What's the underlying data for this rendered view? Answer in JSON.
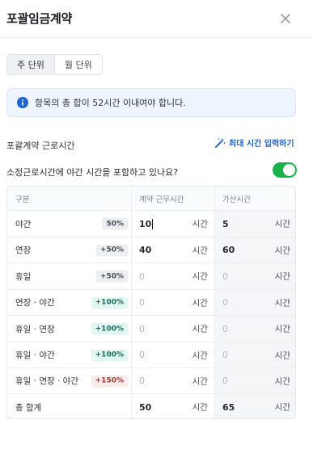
{
  "dialog": {
    "title": "포괄임금계약",
    "close_icon": "close-icon"
  },
  "period_toggle": {
    "options": [
      "주 단위",
      "월 단위"
    ],
    "selected": "주 단위"
  },
  "info": {
    "icon": "info-icon",
    "text": "항목의 총 합이 52시간 이내여야 합니다.",
    "accent": "#1e64d6"
  },
  "section": {
    "title": "포괄계약 근로시간",
    "max_link": "최대 시간 입력하기",
    "max_icon": "magic-wand-icon"
  },
  "night_question": {
    "text": "소정근로시간에 야간 시간을 포함하고 있나요?",
    "toggle_on": true,
    "toggle_color": "#19b24b"
  },
  "table": {
    "headers": [
      "구분",
      "계약 근무시간",
      "가산시간"
    ],
    "unit": "시간",
    "rows": [
      {
        "label": "야간",
        "badge": "50%",
        "badge_style": "gray",
        "contract": "10",
        "extra": "5",
        "contract_filled": true,
        "extra_filled": true,
        "focused": true
      },
      {
        "label": "연장",
        "badge": "+50%",
        "badge_style": "gray",
        "contract": "40",
        "extra": "60",
        "contract_filled": true,
        "extra_filled": true
      },
      {
        "label": "휴일",
        "badge": "+50%",
        "badge_style": "gray",
        "contract": "0",
        "extra": "0",
        "contract_filled": false,
        "extra_filled": false
      },
      {
        "label": "연장 · 야간",
        "badge": "+100%",
        "badge_style": "teal",
        "contract": "0",
        "extra": "0",
        "contract_filled": false,
        "extra_filled": false
      },
      {
        "label": "휴일 · 연장",
        "badge": "+100%",
        "badge_style": "teal",
        "contract": "0",
        "extra": "0",
        "contract_filled": false,
        "extra_filled": false
      },
      {
        "label": "휴일 · 야간",
        "badge": "+100%",
        "badge_style": "teal",
        "contract": "0",
        "extra": "0",
        "contract_filled": false,
        "extra_filled": false
      },
      {
        "label": "휴일 · 연장 · 야간",
        "badge": "+150%",
        "badge_style": "red",
        "contract": "0",
        "extra": "0",
        "contract_filled": false,
        "extra_filled": false
      }
    ],
    "total": {
      "label": "총 합계",
      "contract": "50",
      "extra": "65"
    }
  }
}
